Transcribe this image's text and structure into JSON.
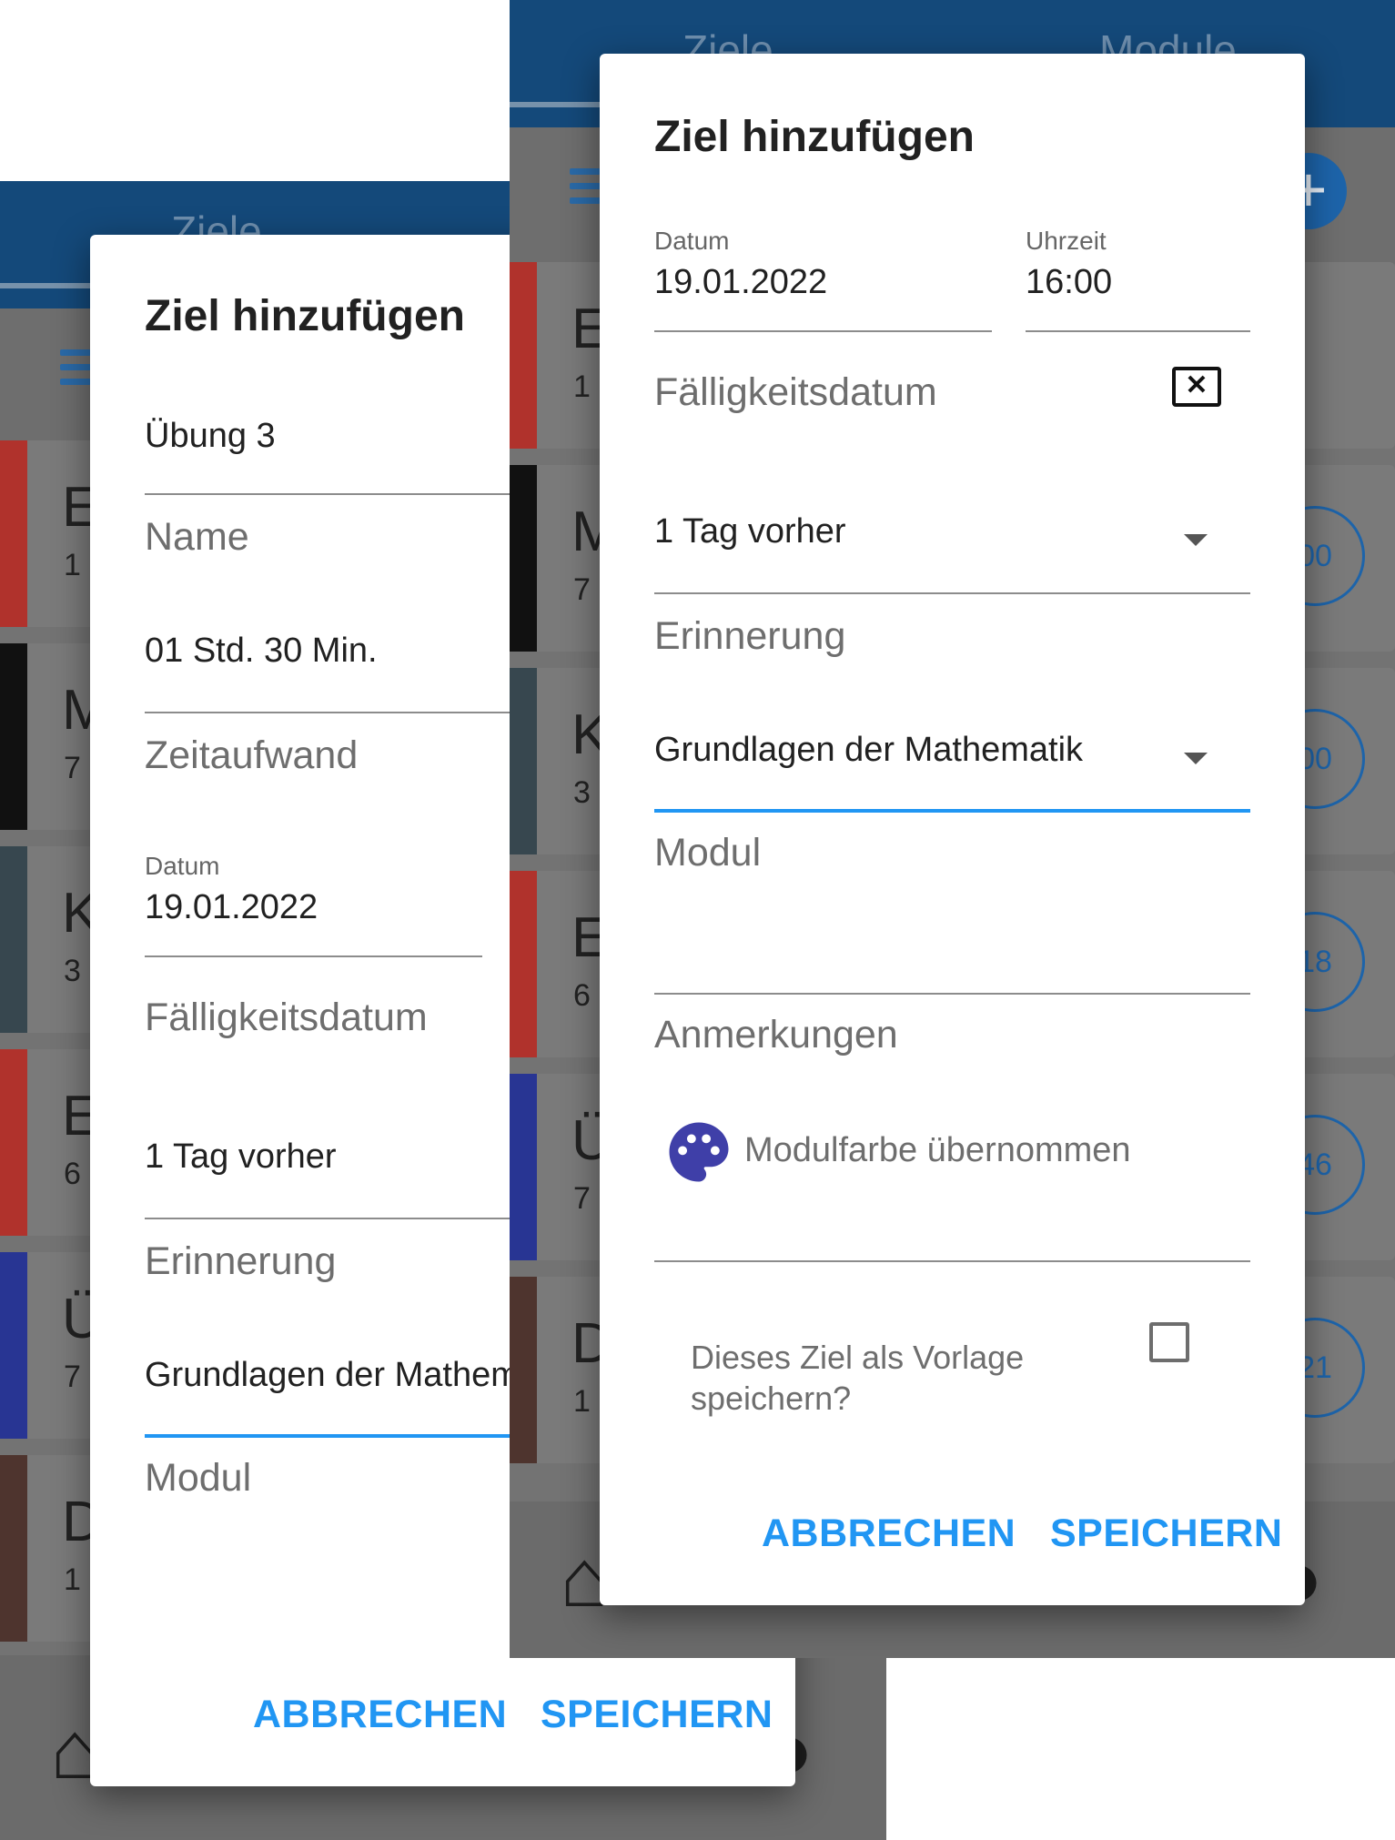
{
  "left_screen": {
    "appbar": {
      "tab_left": "Ziele"
    },
    "cards": [
      {
        "letter": "E",
        "sub": "1",
        "color": "#b0322c"
      },
      {
        "letter": "M",
        "sub": "7",
        "color": "#111111"
      },
      {
        "letter": "K",
        "sub": "3",
        "color": "#37474f"
      },
      {
        "letter": "E",
        "sub": "6",
        "color": "#b0322c"
      },
      {
        "letter": "Ü",
        "sub": "7",
        "color": "#283593"
      },
      {
        "letter": "D",
        "sub": "1",
        "color": "#4e342e"
      }
    ],
    "dialog": {
      "title": "Ziel hinzufügen",
      "name_value": "Übung 3",
      "name_label": "Name",
      "effort_value": "01 Std. 30 Min.",
      "effort_label": "Zeitaufwand",
      "date_small_label": "Datum",
      "date_value": "19.01.2022",
      "due_label": "Fälligkeitsdatum",
      "reminder_value": "1 Tag vorher",
      "reminder_label": "Erinnerung",
      "module_value": "Grundlagen der Mathematik",
      "module_label": "Modul",
      "cancel": "ABBRECHEN",
      "save": "SPEICHERN"
    }
  },
  "right_screen": {
    "appbar": {
      "tab_left": "Ziele",
      "tab_right": "Module"
    },
    "cards": [
      {
        "letter": "E",
        "sub": "1",
        "color": "#b0322c",
        "badge": ""
      },
      {
        "letter": "M",
        "sub": "7",
        "color": "#111111",
        "badge": "00"
      },
      {
        "letter": "K",
        "sub": "3",
        "color": "#37474f",
        "badge": "00"
      },
      {
        "letter": "E",
        "sub": "6",
        "color": "#b0322c",
        "badge": "18"
      },
      {
        "letter": "Ü",
        "sub": "7",
        "color": "#283593",
        "badge": "46"
      },
      {
        "letter": "D",
        "sub": "1",
        "color": "#4e342e",
        "badge": "21"
      }
    ],
    "dialog": {
      "title": "Ziel hinzufügen",
      "date_small_label": "Datum",
      "date_value": "19.01.2022",
      "time_small_label": "Uhrzeit",
      "time_value": "16:00",
      "due_label": "Fälligkeitsdatum",
      "clear_glyph": "✕",
      "reminder_value": "1 Tag vorher",
      "reminder_label": "Erinnerung",
      "module_value": "Grundlagen der Mathematik",
      "module_label": "Modul",
      "notes_label": "Anmerkungen",
      "color_text": "Modulfarbe übernommen",
      "palette_color": "#3f3fa8",
      "template_text": "Dieses Ziel als Vorlage speichern?",
      "template_checked": false,
      "cancel": "ABBRECHEN",
      "save": "SPEICHERN"
    }
  },
  "colors": {
    "accent": "#2196f3",
    "appbar": "#14497a"
  }
}
